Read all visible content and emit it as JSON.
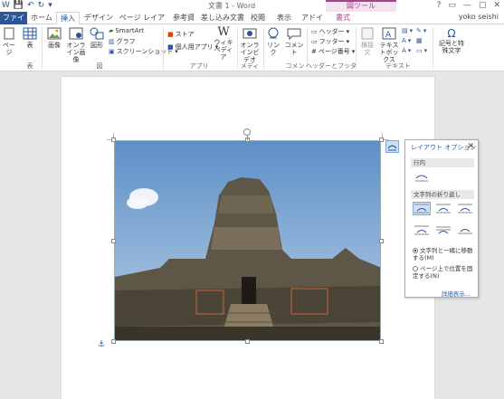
{
  "titlebar": {
    "doc_title": "文書 1 - Word",
    "context_title": "図ツール",
    "qat": [
      "W",
      "💾",
      "↶",
      "↻",
      "▾"
    ],
    "win": [
      "?",
      "▭",
      "—",
      "▢",
      "✕"
    ]
  },
  "tabs": [
    {
      "label": "ファイル"
    },
    {
      "label": "ホーム"
    },
    {
      "label": "挿入"
    },
    {
      "label": "デザイン"
    },
    {
      "label": "ページ レイアウト"
    },
    {
      "label": "参考資料"
    },
    {
      "label": "差し込み文書"
    },
    {
      "label": "校閲"
    },
    {
      "label": "表示"
    },
    {
      "label": "アドイン"
    },
    {
      "label": "書式"
    }
  ],
  "user": "yoko seishi",
  "ribbon": {
    "page": "ページ",
    "table": "表",
    "table_group": "表",
    "picture": "画像",
    "online_picture": "オンライン画像",
    "shapes": "図形",
    "smartart": "SmartArt",
    "chart": "グラフ",
    "screenshot": "スクリーンショット",
    "illust_group": "図",
    "store": "ストア",
    "my_apps": "個人用アプリ",
    "wiki": "ウィキペディア",
    "apps_group": "アプリ",
    "online_video": "オンラインビデオ",
    "media_group": "メディア",
    "link": "リンク",
    "comment": "コメント",
    "comment_group": "コメント",
    "header": "ヘッダー",
    "footer": "フッター",
    "page_number": "ページ番号",
    "hf_group": "ヘッダーとフッター",
    "textbox_hidden": "横接文",
    "textbox": "テキストボックス",
    "text_group": "テキスト",
    "symbol": "記号と特殊文字"
  },
  "panel": {
    "title": "レイアウト オプション",
    "close": "✕",
    "section_inline": "行内",
    "section_wrap": "文字列の折り返し",
    "radio1": "文字列と一緒に移動する(M)",
    "radio2": "ページ上で位置を固定する(N)",
    "more": "詳細表示..."
  },
  "anchor": "⚓"
}
